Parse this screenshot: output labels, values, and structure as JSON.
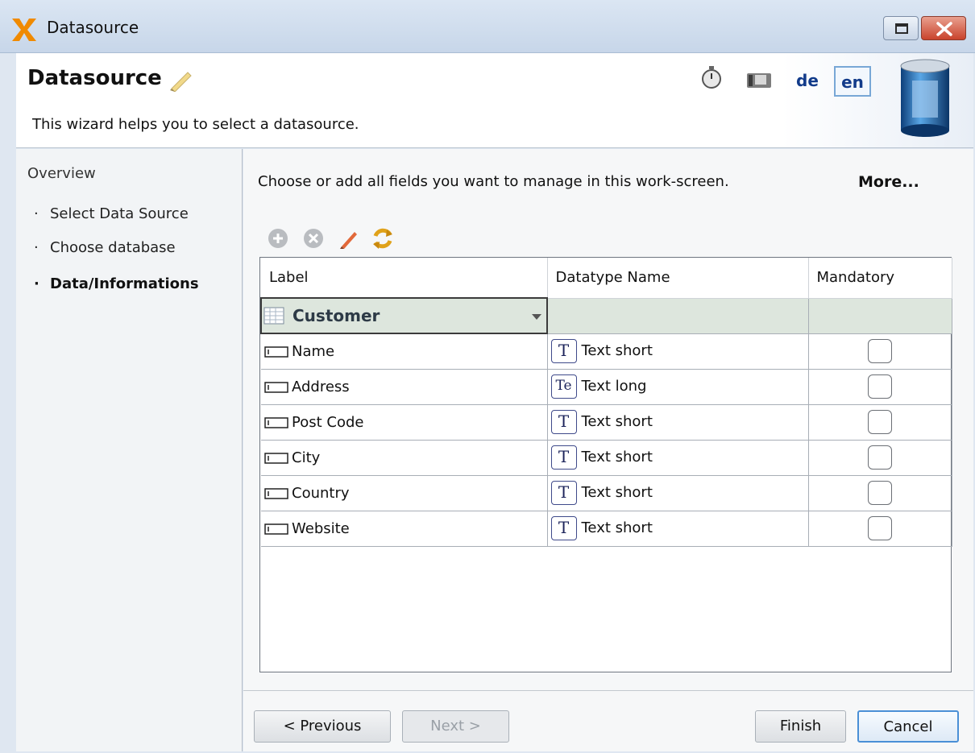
{
  "window": {
    "title": "Datasource"
  },
  "header": {
    "title": "Datasource",
    "description": "This wizard helps you to select a datasource.",
    "languages": [
      "de",
      "en"
    ],
    "selected_language": "en"
  },
  "sidebar": {
    "overview": "Overview",
    "steps": [
      {
        "label": "Select Data Source",
        "active": false
      },
      {
        "label": "Choose database",
        "active": false
      },
      {
        "label": "Data/Informations",
        "active": true
      }
    ],
    "bullet": "·"
  },
  "main": {
    "instructions": "Choose or add all fields you want to manage in this work-screen.",
    "more_link": "More..."
  },
  "grid": {
    "columns": [
      "Label",
      "Datatype Name",
      "Mandatory"
    ],
    "group": "Customer",
    "rows": [
      {
        "label": "Name",
        "type_icon": "T",
        "datatype": "Text short",
        "mandatory": false
      },
      {
        "label": "Address",
        "type_icon": "Te",
        "datatype": "Text long",
        "mandatory": false
      },
      {
        "label": "Post Code",
        "type_icon": "T",
        "datatype": "Text short",
        "mandatory": false
      },
      {
        "label": "City",
        "type_icon": "T",
        "datatype": "Text short",
        "mandatory": false
      },
      {
        "label": "Country",
        "type_icon": "T",
        "datatype": "Text short",
        "mandatory": false
      },
      {
        "label": "Website",
        "type_icon": "T",
        "datatype": "Text short",
        "mandatory": false
      }
    ]
  },
  "buttons": {
    "previous": "< Previous",
    "next": "Next >",
    "finish": "Finish",
    "cancel": "Cancel"
  },
  "colors": {
    "accent": "#4a8fd6",
    "group_row": "#dde6dd",
    "close_button": "#c9432c"
  },
  "icons": {
    "app": "x-logo-icon",
    "header": [
      "pencil-icon",
      "stopwatch-icon",
      "camera-icon",
      "database-icon"
    ],
    "toolbar": [
      "add-icon",
      "remove-icon",
      "edit-icon",
      "refresh-icon"
    ]
  }
}
